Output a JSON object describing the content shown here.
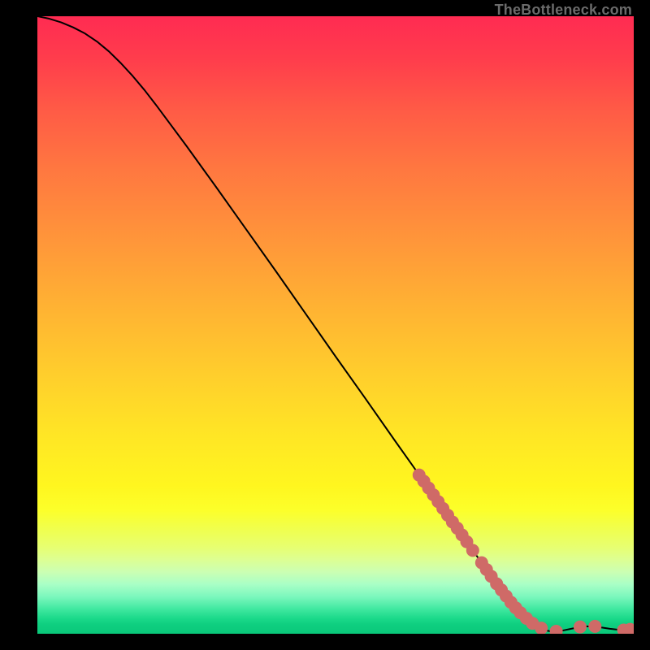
{
  "watermark": "TheBottleneck.com",
  "colors": {
    "curve_stroke": "#000000",
    "marker_fill": "#cf6a67",
    "marker_stroke": "#cf6a67"
  },
  "chart_data": {
    "type": "line",
    "title": "",
    "xlabel": "",
    "ylabel": "",
    "xlim": [
      0,
      100
    ],
    "ylim": [
      0,
      100
    ],
    "curve": [
      {
        "x": 0,
        "y": 100.0
      },
      {
        "x": 2,
        "y": 99.6
      },
      {
        "x": 4,
        "y": 99.0
      },
      {
        "x": 6,
        "y": 98.2
      },
      {
        "x": 8,
        "y": 97.2
      },
      {
        "x": 10,
        "y": 95.9
      },
      {
        "x": 12,
        "y": 94.3
      },
      {
        "x": 14,
        "y": 92.4
      },
      {
        "x": 16,
        "y": 90.3
      },
      {
        "x": 18,
        "y": 88.0
      },
      {
        "x": 20,
        "y": 85.5
      },
      {
        "x": 25,
        "y": 79.0
      },
      {
        "x": 30,
        "y": 72.3
      },
      {
        "x": 35,
        "y": 65.5
      },
      {
        "x": 40,
        "y": 58.7
      },
      {
        "x": 45,
        "y": 51.8
      },
      {
        "x": 50,
        "y": 44.9
      },
      {
        "x": 55,
        "y": 38.1
      },
      {
        "x": 60,
        "y": 31.2
      },
      {
        "x": 65,
        "y": 24.4
      },
      {
        "x": 70,
        "y": 17.6
      },
      {
        "x": 75,
        "y": 10.8
      },
      {
        "x": 78,
        "y": 6.9
      },
      {
        "x": 81,
        "y": 3.4
      },
      {
        "x": 83,
        "y": 1.6
      },
      {
        "x": 85,
        "y": 0.6
      },
      {
        "x": 86.5,
        "y": 0.3
      },
      {
        "x": 88,
        "y": 0.5
      },
      {
        "x": 90,
        "y": 0.9
      },
      {
        "x": 92,
        "y": 1.2
      },
      {
        "x": 94,
        "y": 1.1
      },
      {
        "x": 96,
        "y": 0.8
      },
      {
        "x": 98,
        "y": 0.6
      },
      {
        "x": 100,
        "y": 0.7
      }
    ],
    "markers": [
      {
        "x": 64.0,
        "y": 25.7
      },
      {
        "x": 64.8,
        "y": 24.7
      },
      {
        "x": 65.6,
        "y": 23.6
      },
      {
        "x": 66.4,
        "y": 22.5
      },
      {
        "x": 67.2,
        "y": 21.4
      },
      {
        "x": 68.0,
        "y": 20.3
      },
      {
        "x": 68.8,
        "y": 19.2
      },
      {
        "x": 69.6,
        "y": 18.1
      },
      {
        "x": 70.4,
        "y": 17.1
      },
      {
        "x": 71.2,
        "y": 16.0
      },
      {
        "x": 72.0,
        "y": 14.9
      },
      {
        "x": 73.0,
        "y": 13.5
      },
      {
        "x": 74.5,
        "y": 11.5
      },
      {
        "x": 75.3,
        "y": 10.4
      },
      {
        "x": 76.1,
        "y": 9.3
      },
      {
        "x": 77.0,
        "y": 8.1
      },
      {
        "x": 77.8,
        "y": 7.1
      },
      {
        "x": 78.6,
        "y": 6.1
      },
      {
        "x": 79.4,
        "y": 5.1
      },
      {
        "x": 80.2,
        "y": 4.2
      },
      {
        "x": 81.0,
        "y": 3.4
      },
      {
        "x": 82.0,
        "y": 2.5
      },
      {
        "x": 83.0,
        "y": 1.7
      },
      {
        "x": 84.5,
        "y": 0.9
      },
      {
        "x": 87.0,
        "y": 0.4
      },
      {
        "x": 91.0,
        "y": 1.1
      },
      {
        "x": 93.5,
        "y": 1.2
      },
      {
        "x": 98.3,
        "y": 0.6
      },
      {
        "x": 99.4,
        "y": 0.7
      }
    ]
  }
}
